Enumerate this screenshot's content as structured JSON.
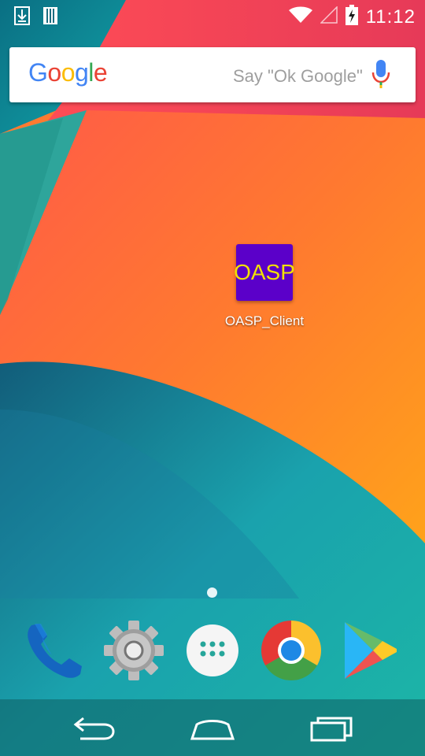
{
  "status_bar": {
    "time": "11:12",
    "left_icons": [
      "download-icon",
      "sim-card-icon"
    ],
    "right_icons": [
      "wifi-icon",
      "cell-signal-icon",
      "battery-charging-icon"
    ]
  },
  "search_bar": {
    "logo_letters": [
      {
        "ch": "G",
        "color": "#4285F4"
      },
      {
        "ch": "o",
        "color": "#EA4335"
      },
      {
        "ch": "o",
        "color": "#FBBC05"
      },
      {
        "ch": "g",
        "color": "#4285F4"
      },
      {
        "ch": "l",
        "color": "#34A853"
      },
      {
        "ch": "e",
        "color": "#EA4335"
      }
    ],
    "hint": "Say \"Ok Google\"",
    "mic_icon": "mic-icon"
  },
  "home_shortcut": {
    "tile_text": "OASP",
    "label": "OASP_Client",
    "tile_color": "#5b00c9",
    "tile_text_color": "#f2e100"
  },
  "dock": [
    "phone-icon",
    "settings-icon",
    "app-drawer-icon",
    "chrome-icon",
    "play-store-icon"
  ],
  "nav_bar": [
    "back-icon",
    "home-icon",
    "recents-icon"
  ]
}
